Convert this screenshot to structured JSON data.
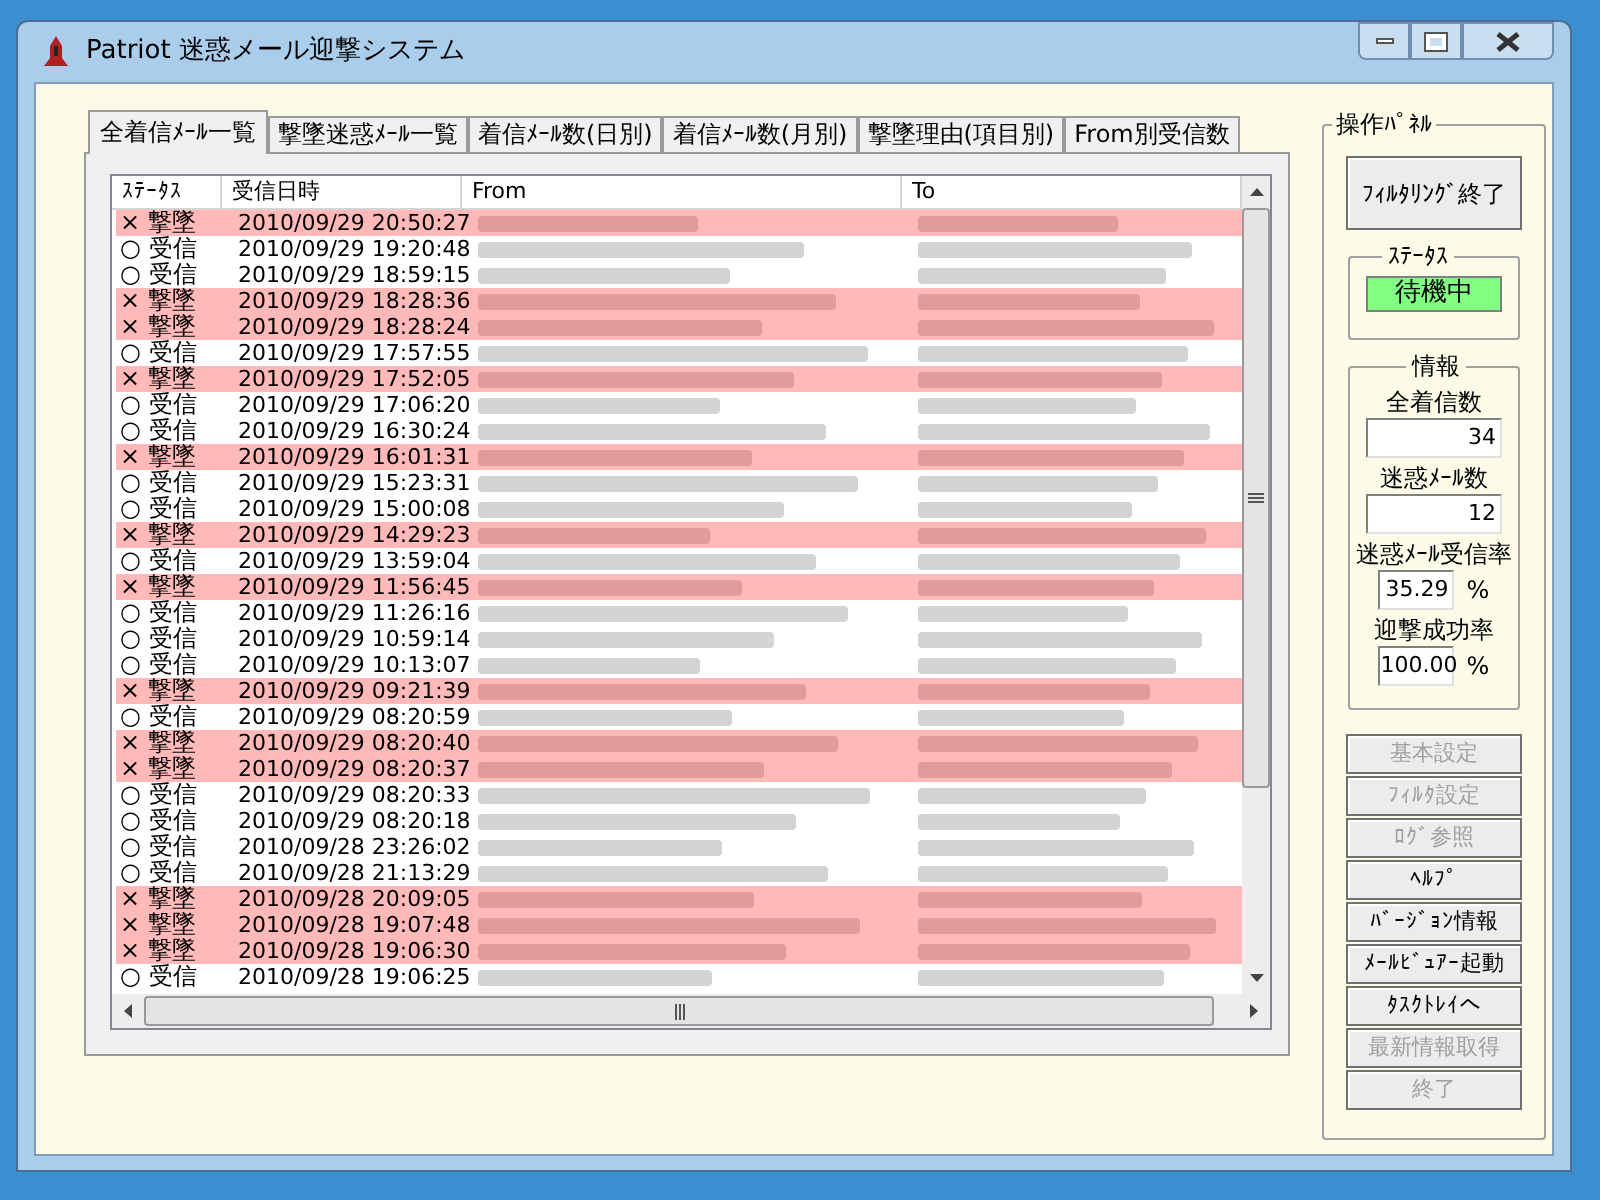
{
  "window": {
    "title": "Patriot 迷惑メール迎撃システム"
  },
  "tabs": [
    {
      "label": "全着信ﾒｰﾙ一覧",
      "selected": true
    },
    {
      "label": "撃墜迷惑ﾒｰﾙ一覧",
      "selected": false
    },
    {
      "label": "着信ﾒｰﾙ数(日別)",
      "selected": false
    },
    {
      "label": "着信ﾒｰﾙ数(月別)",
      "selected": false
    },
    {
      "label": "撃墜理由(項目別)",
      "selected": false
    },
    {
      "label": "From別受信数",
      "selected": false
    }
  ],
  "table": {
    "columns": [
      "ｽﾃｰﾀｽ",
      "受信日時",
      "From",
      "To"
    ],
    "rows": [
      {
        "kind": "blocked",
        "status": "× 撃墜",
        "received": "2010/09/29 20:50:27"
      },
      {
        "kind": "received",
        "status": "○ 受信",
        "received": "2010/09/29 19:20:48"
      },
      {
        "kind": "received",
        "status": "○ 受信",
        "received": "2010/09/29 18:59:15"
      },
      {
        "kind": "blocked",
        "status": "× 撃墜",
        "received": "2010/09/29 18:28:36"
      },
      {
        "kind": "blocked",
        "status": "× 撃墜",
        "received": "2010/09/29 18:28:24"
      },
      {
        "kind": "received",
        "status": "○ 受信",
        "received": "2010/09/29 17:57:55"
      },
      {
        "kind": "blocked",
        "status": "× 撃墜",
        "received": "2010/09/29 17:52:05"
      },
      {
        "kind": "received",
        "status": "○ 受信",
        "received": "2010/09/29 17:06:20"
      },
      {
        "kind": "received",
        "status": "○ 受信",
        "received": "2010/09/29 16:30:24"
      },
      {
        "kind": "blocked",
        "status": "× 撃墜",
        "received": "2010/09/29 16:01:31"
      },
      {
        "kind": "received",
        "status": "○ 受信",
        "received": "2010/09/29 15:23:31"
      },
      {
        "kind": "received",
        "status": "○ 受信",
        "received": "2010/09/29 15:00:08"
      },
      {
        "kind": "blocked",
        "status": "× 撃墜",
        "received": "2010/09/29 14:29:23"
      },
      {
        "kind": "received",
        "status": "○ 受信",
        "received": "2010/09/29 13:59:04"
      },
      {
        "kind": "blocked",
        "status": "× 撃墜",
        "received": "2010/09/29 11:56:45"
      },
      {
        "kind": "received",
        "status": "○ 受信",
        "received": "2010/09/29 11:26:16"
      },
      {
        "kind": "received",
        "status": "○ 受信",
        "received": "2010/09/29 10:59:14"
      },
      {
        "kind": "received",
        "status": "○ 受信",
        "received": "2010/09/29 10:13:07"
      },
      {
        "kind": "blocked",
        "status": "× 撃墜",
        "received": "2010/09/29 09:21:39"
      },
      {
        "kind": "received",
        "status": "○ 受信",
        "received": "2010/09/29 08:20:59"
      },
      {
        "kind": "blocked",
        "status": "× 撃墜",
        "received": "2010/09/29 08:20:40"
      },
      {
        "kind": "blocked",
        "status": "× 撃墜",
        "received": "2010/09/29 08:20:37"
      },
      {
        "kind": "received",
        "status": "○ 受信",
        "received": "2010/09/29 08:20:33"
      },
      {
        "kind": "received",
        "status": "○ 受信",
        "received": "2010/09/29 08:20:18"
      },
      {
        "kind": "received",
        "status": "○ 受信",
        "received": "2010/09/28 23:26:02"
      },
      {
        "kind": "received",
        "status": "○ 受信",
        "received": "2010/09/28 21:13:29"
      },
      {
        "kind": "blocked",
        "status": "× 撃墜",
        "received": "2010/09/28 20:09:05"
      },
      {
        "kind": "blocked",
        "status": "× 撃墜",
        "received": "2010/09/28 19:07:48"
      },
      {
        "kind": "blocked",
        "status": "× 撃墜",
        "received": "2010/09/28 19:06:30"
      },
      {
        "kind": "received",
        "status": "○ 受信",
        "received": "2010/09/28 19:06:25"
      }
    ]
  },
  "panel": {
    "title": "操作ﾊﾟﾈﾙ",
    "filter_button": "ﾌｨﾙﾀﾘﾝｸﾞ終了",
    "status": {
      "title": "ｽﾃｰﾀｽ",
      "value": "待機中"
    },
    "info": {
      "title": "情報",
      "fields": [
        {
          "label": "全着信数",
          "value": "34"
        },
        {
          "label": "迷惑ﾒｰﾙ数",
          "value": "12"
        },
        {
          "label": "迷惑ﾒｰﾙ受信率",
          "value": "35.29",
          "unit": "%"
        },
        {
          "label": "迎撃成功率",
          "value": "100.00",
          "unit": "%"
        }
      ]
    },
    "buttons": [
      {
        "label": "基本設定",
        "disabled": true
      },
      {
        "label": "ﾌｨﾙﾀ設定",
        "disabled": true
      },
      {
        "label": "ﾛｸﾞ参照",
        "disabled": true
      },
      {
        "label": "ﾍﾙﾌﾟ",
        "disabled": false
      },
      {
        "label": "ﾊﾞｰｼﾞｮﾝ情報",
        "disabled": false
      },
      {
        "label": "ﾒｰﾙﾋﾞｭｱｰ起動",
        "disabled": false
      },
      {
        "label": "ﾀｽｸﾄﾚｲへ",
        "disabled": false
      },
      {
        "label": "最新情報取得",
        "disabled": true
      },
      {
        "label": "終了",
        "disabled": true
      }
    ]
  }
}
